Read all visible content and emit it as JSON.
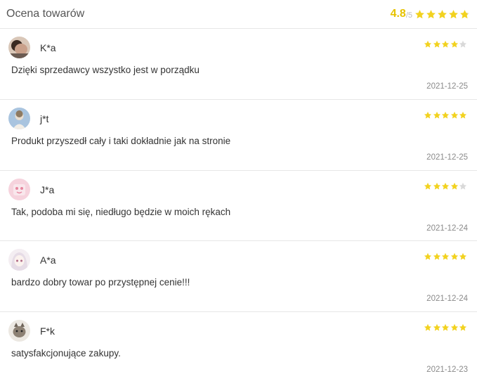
{
  "header": {
    "title": "Ocena towarów",
    "score": "4.8",
    "score_max": "/5",
    "rating": 4.8
  },
  "colors": {
    "star": "#f2d21f",
    "star_empty": "#d9d9d9",
    "score": "#e6c200"
  },
  "reviews": [
    {
      "user": "K*a",
      "rating": 4,
      "text": "Dzięki sprzedawcy wszystko jest w porządku",
      "date": "2021-12-25",
      "avatar_icon": "portrait-avatar-icon"
    },
    {
      "user": "j*t",
      "rating": 5,
      "text": "Produkt przyszedł cały i taki dokładnie jak na stronie",
      "date": "2021-12-25",
      "avatar_icon": "blue-sky-avatar-icon"
    },
    {
      "user": "J*a",
      "rating": 4,
      "text": "Tak, podoba mi się, niedługo będzie w moich rękach",
      "date": "2021-12-24",
      "avatar_icon": "pink-avatar-icon"
    },
    {
      "user": "A*a",
      "rating": 5,
      "text": "bardzo dobry towar po przystępnej cenie!!!",
      "date": "2021-12-24",
      "avatar_icon": "anime-girl-avatar-icon"
    },
    {
      "user": "F*k",
      "rating": 5,
      "text": "satysfakcjonujące zakupy.",
      "date": "2021-12-23",
      "avatar_icon": "cat-avatar-icon"
    }
  ]
}
